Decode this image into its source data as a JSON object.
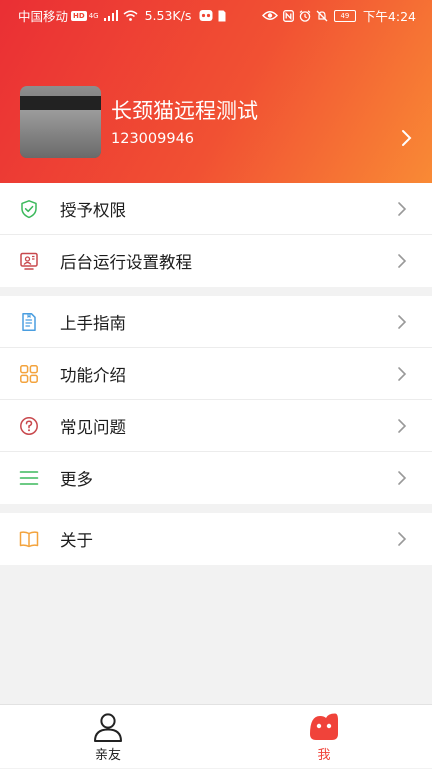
{
  "status_bar": {
    "carrier": "中国移动",
    "hd_badge": "HD",
    "network": "4G",
    "speed": "5.53K/s",
    "battery": "49",
    "time": "下午4:24"
  },
  "profile": {
    "name": "长颈猫远程测试",
    "id": "123009946"
  },
  "menu": {
    "group1": [
      {
        "label": "授予权限",
        "icon": "shield-check-icon"
      },
      {
        "label": "后台运行设置教程",
        "icon": "screen-person-icon"
      }
    ],
    "group2": [
      {
        "label": "上手指南",
        "icon": "document-icon"
      },
      {
        "label": "功能介绍",
        "icon": "grid-icon"
      },
      {
        "label": "常见问题",
        "icon": "question-circle-icon"
      },
      {
        "label": "更多",
        "icon": "menu-lines-icon"
      }
    ],
    "group3": [
      {
        "label": "关于",
        "icon": "book-icon"
      }
    ]
  },
  "bottom_nav": {
    "items": [
      {
        "label": "亲友",
        "icon": "person-icon",
        "active": false
      },
      {
        "label": "我",
        "icon": "cat-face-icon",
        "active": true
      }
    ]
  },
  "colors": {
    "gradient_start": "#ea2f34",
    "gradient_end": "#f98a35",
    "active": "#f0433a",
    "green": "#3cb95c",
    "red_icon": "#c8484d",
    "blue_icon": "#4a9ee0",
    "orange_icon": "#f3a33d"
  }
}
